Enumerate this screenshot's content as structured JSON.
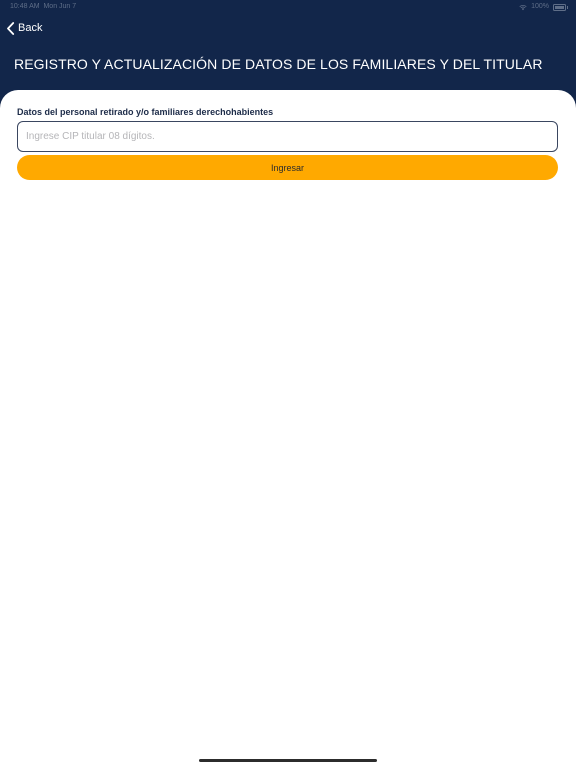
{
  "status_bar": {
    "time": "10:48 AM",
    "date": "Mon Jun 7",
    "battery": "100%"
  },
  "nav": {
    "back_label": "Back"
  },
  "header": {
    "title": "REGISTRO Y ACTUALIZACIÓN DE DATOS DE LOS FAMILIARES Y DEL TITULAR"
  },
  "form": {
    "label": "Datos del personal retirado y/o familiares derechohabientes",
    "cip_input": {
      "value": "",
      "placeholder": "Ingrese CIP titular 08 dígitos."
    },
    "submit_label": "Ingresar"
  },
  "colors": {
    "header_bg": "#12264a",
    "accent": "#ffa900",
    "card_bg": "#ffffff"
  },
  "icons": {
    "back": "chevron-left-icon",
    "wifi": "wifi-icon",
    "battery": "battery-icon"
  }
}
